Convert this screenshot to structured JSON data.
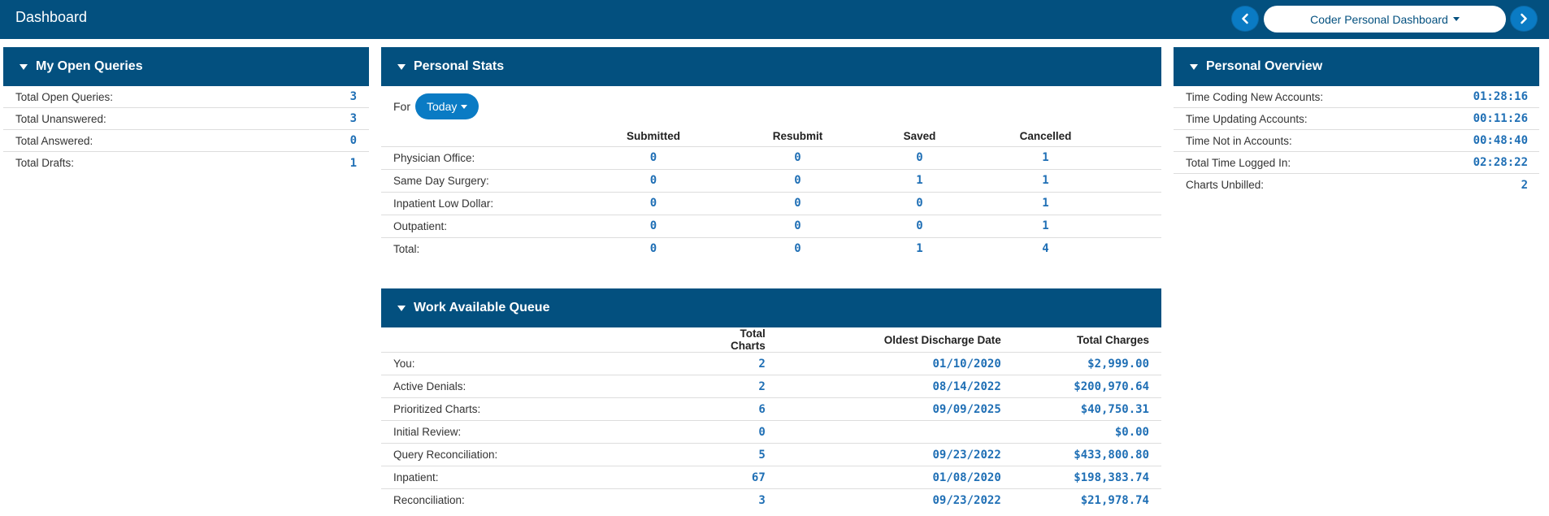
{
  "app": {
    "title": "Dashboard"
  },
  "dashboard_selector": {
    "selected": "Coder Personal Dashboard"
  },
  "colors": {
    "header": "#03507f",
    "accent": "#0a7bc4",
    "value": "#1f6fb5"
  },
  "open_queries": {
    "title": "My Open Queries",
    "rows": [
      {
        "label": "Total Open Queries:",
        "value": "3"
      },
      {
        "label": "Total Unanswered:",
        "value": "3"
      },
      {
        "label": "Total Answered:",
        "value": "0"
      },
      {
        "label": "Total Drafts:",
        "value": "1"
      }
    ]
  },
  "personal_stats": {
    "title": "Personal Stats",
    "for_label": "For",
    "period": "Today",
    "columns": [
      "Submitted",
      "Resubmit",
      "Saved",
      "Cancelled"
    ],
    "rows": [
      {
        "label": "Physician Office:",
        "values": [
          "0",
          "0",
          "0",
          "1"
        ]
      },
      {
        "label": "Same Day Surgery:",
        "values": [
          "0",
          "0",
          "1",
          "1"
        ]
      },
      {
        "label": "Inpatient Low Dollar:",
        "values": [
          "0",
          "0",
          "0",
          "1"
        ]
      },
      {
        "label": "Outpatient:",
        "values": [
          "0",
          "0",
          "0",
          "1"
        ]
      },
      {
        "label": "Total:",
        "values": [
          "0",
          "0",
          "1",
          "4"
        ]
      }
    ]
  },
  "personal_overview": {
    "title": "Personal Overview",
    "rows": [
      {
        "label": "Time Coding New Accounts:",
        "value": "01:28:16"
      },
      {
        "label": "Time Updating Accounts:",
        "value": "00:11:26"
      },
      {
        "label": "Time Not in Accounts:",
        "value": "00:48:40"
      },
      {
        "label": "Total Time Logged In:",
        "value": "02:28:22"
      },
      {
        "label": "Charts Unbilled:",
        "value": "2"
      }
    ]
  },
  "work_queue": {
    "title": "Work Available Queue",
    "columns": [
      "Total Charts",
      "Oldest Discharge Date",
      "Total Charges"
    ],
    "rows": [
      {
        "label": "You:",
        "values": [
          "2",
          "01/10/2020",
          "$2,999.00"
        ]
      },
      {
        "label": "Active Denials:",
        "values": [
          "2",
          "08/14/2022",
          "$200,970.64"
        ]
      },
      {
        "label": "Prioritized Charts:",
        "values": [
          "6",
          "09/09/2025",
          "$40,750.31"
        ]
      },
      {
        "label": "Initial Review:",
        "values": [
          "0",
          "",
          "$0.00"
        ]
      },
      {
        "label": "Query Reconciliation:",
        "values": [
          "5",
          "09/23/2022",
          "$433,800.80"
        ]
      },
      {
        "label": "Inpatient:",
        "values": [
          "67",
          "01/08/2020",
          "$198,383.74"
        ]
      },
      {
        "label": "Reconciliation:",
        "values": [
          "3",
          "09/23/2022",
          "$21,978.74"
        ]
      }
    ]
  }
}
